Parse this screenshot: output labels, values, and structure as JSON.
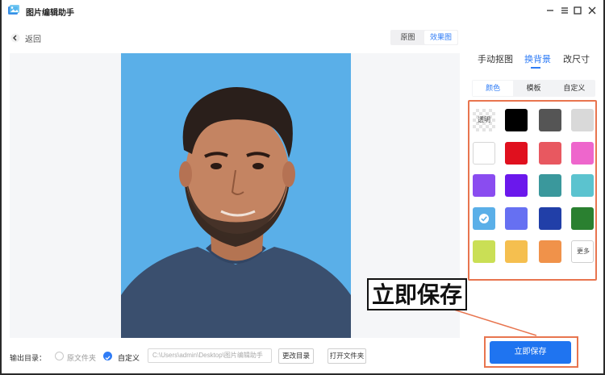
{
  "app": {
    "title": "图片编辑助手"
  },
  "nav": {
    "back_label": "返回"
  },
  "view_toggle": {
    "original": "原图",
    "result": "效果图",
    "active": "result"
  },
  "side_tabs": {
    "cutout": "手动抠图",
    "background": "换背景",
    "resize": "改尺寸",
    "active": "background"
  },
  "sub_tabs": {
    "color": "颜色",
    "template": "模板",
    "custom": "自定义",
    "active": "color"
  },
  "swatches": {
    "transparent_label": "透明",
    "more_label": "更多",
    "colors": [
      "transparent",
      "#000000",
      "#555555",
      "#d9d9d9",
      "#ffffff",
      "#e0101e",
      "#e85860",
      "#ee66cc",
      "#8a4cf0",
      "#6b18ec",
      "#3a989c",
      "#5bc3cf",
      "#5aafe8",
      "#6670f2",
      "#213fa8",
      "#2a8030",
      "#cadf55",
      "#f5bf4f",
      "#f0924a",
      "more"
    ],
    "selected_index": 12
  },
  "callout": {
    "text": "立即保存"
  },
  "output": {
    "label": "输出目录：",
    "option_original": "原文件夹",
    "option_custom": "自定义",
    "selected": "custom",
    "path_value": "C:\\Users\\admin\\Desktop\\图片编辑助手",
    "change_dir_label": "更改目录",
    "open_folder_label": "打开文件夹"
  },
  "actions": {
    "save_label": "立即保存"
  },
  "colors": {
    "accent": "#2f7cf6",
    "save_button": "#1f74f0",
    "highlight_border": "#e8754f",
    "photo_background": "#5aafe8"
  }
}
